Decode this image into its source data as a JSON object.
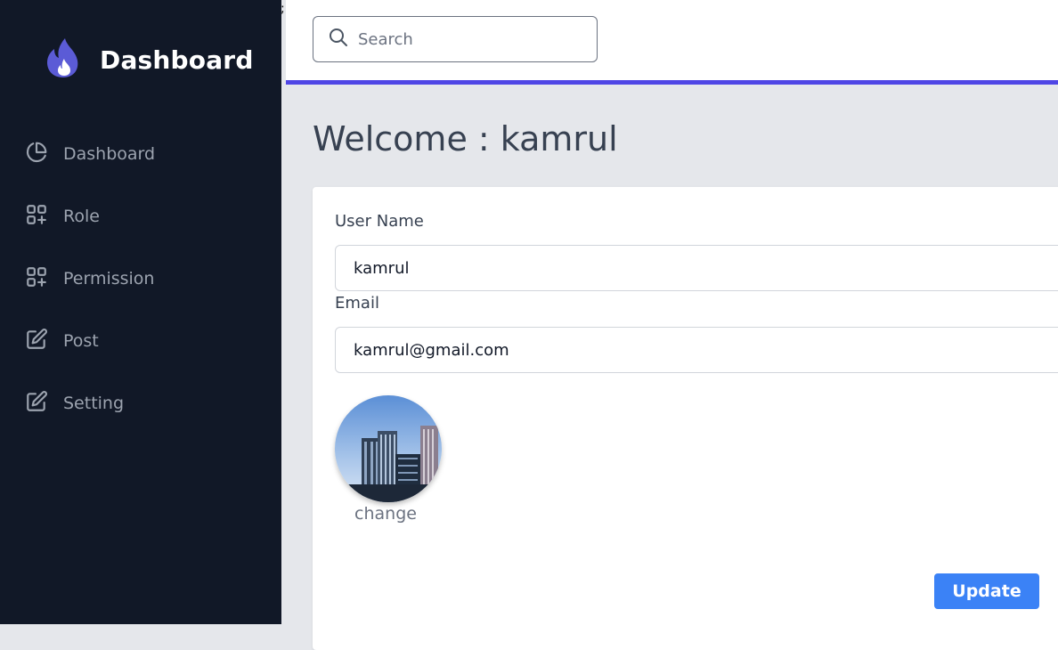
{
  "brand": {
    "title": "Dashboard",
    "icon": "flame-icon",
    "accent": "#4f46e5"
  },
  "sidebar": {
    "items": [
      {
        "label": "Dashboard",
        "icon": "pie-chart-icon"
      },
      {
        "label": "Role",
        "icon": "grid-plus-icon"
      },
      {
        "label": "Permission",
        "icon": "grid-plus-icon"
      },
      {
        "label": "Post",
        "icon": "edit-icon"
      },
      {
        "label": "Setting",
        "icon": "edit-icon"
      }
    ]
  },
  "stray_text": ";",
  "search": {
    "placeholder": "Search",
    "value": ""
  },
  "main": {
    "welcome": "Welcome : kamrul",
    "form": {
      "username_label": "User Name",
      "username_value": "kamrul",
      "email_label": "Email",
      "email_value": "kamrul@gmail.com",
      "avatar_change_label": "change",
      "update_label": "Update"
    }
  },
  "colors": {
    "sidebar_bg": "#111827",
    "accent_bar": "#4f46e5",
    "update_button": "#3b82f6",
    "page_bg": "#e5e7eb"
  }
}
